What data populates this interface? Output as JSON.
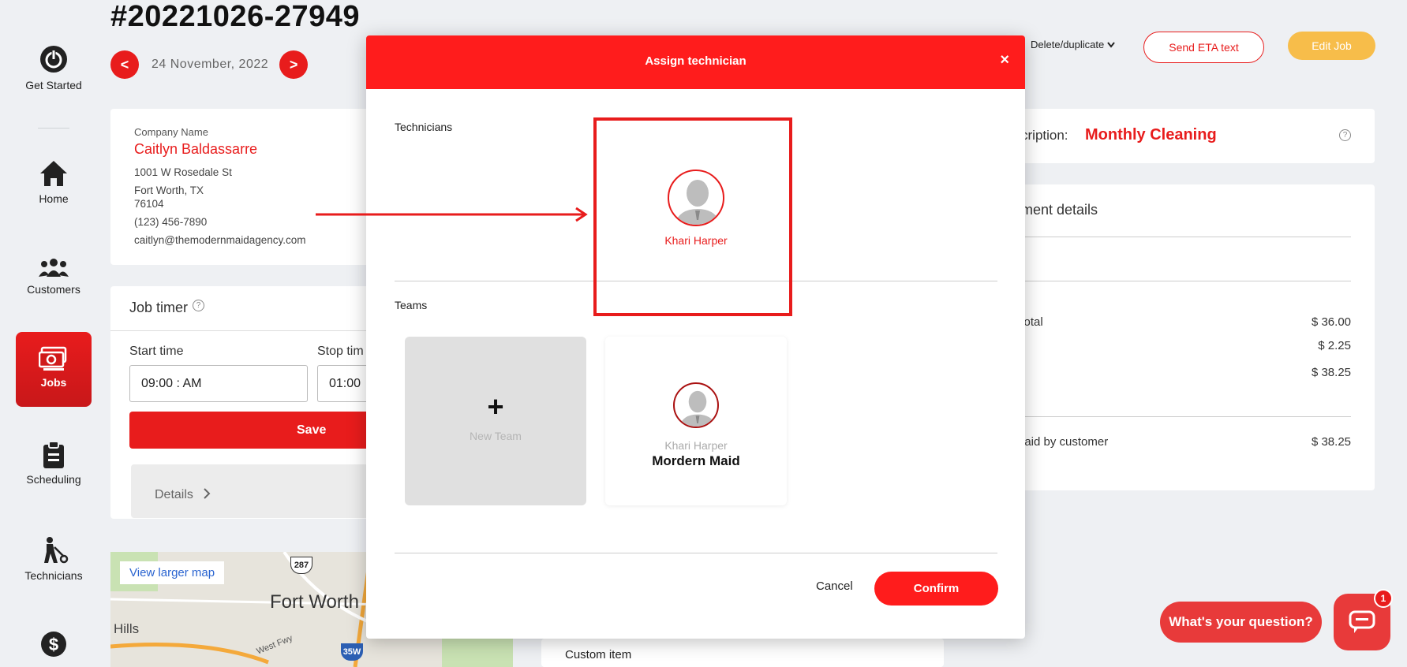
{
  "header": {
    "job_number": "#20221026-27949",
    "date": "24 November, 2022",
    "prev_glyph": "<",
    "next_glyph": ">",
    "delete_duplicate": "Delete/duplicate",
    "send_eta": "Send ETA text",
    "edit_job": "Edit Job"
  },
  "sidebar": {
    "items": [
      {
        "label": "Get Started",
        "icon": "power-icon"
      },
      {
        "label": "Home",
        "icon": "home-icon"
      },
      {
        "label": "Customers",
        "icon": "customers-icon"
      },
      {
        "label": "Jobs",
        "icon": "jobs-icon"
      },
      {
        "label": "Scheduling",
        "icon": "clipboard-icon"
      },
      {
        "label": "Technicians",
        "icon": "technician-icon"
      },
      {
        "label": "",
        "icon": "dollar-icon"
      }
    ]
  },
  "company": {
    "label": "Company Name",
    "name": "Caitlyn Baldassarre",
    "street": "1001 W Rosedale St",
    "city_state": "Fort Worth, TX",
    "zip": "76104",
    "phone": "(123) 456-7890",
    "email": "caitlyn@themodernmaidagency.com"
  },
  "timer": {
    "title": "Job timer",
    "start_label": "Start time",
    "stop_label": "Stop tim",
    "start_value": "09:00 : AM",
    "stop_value": "01:00",
    "save_label": "Save",
    "details_label": "Details"
  },
  "map": {
    "link": "View larger map",
    "city": "Fort Worth",
    "hills": "Hills",
    "freeway": "West Fwy",
    "shield_287": "287",
    "shield_35w": "35W"
  },
  "custom_item": "Custom item",
  "right": {
    "desc_label": "cription:",
    "desc_value": "Monthly Cleaning",
    "payment_title": "ment details",
    "rows": [
      {
        "label": "Total",
        "amount": "$ 36.00"
      },
      {
        "label": "",
        "amount": "$ 2.25"
      },
      {
        "label": "",
        "amount": "$ 38.25"
      },
      {
        "label": "paid by customer",
        "amount": "$ 38.25"
      }
    ]
  },
  "modal": {
    "title": "Assign technician",
    "close": "×",
    "technicians_label": "Technicians",
    "technician_name": "Khari Harper",
    "teams_label": "Teams",
    "new_team_plus": "+",
    "new_team_label": "New Team",
    "team_member": "Khari Harper",
    "team_name": "Mordern Maid",
    "cancel": "Cancel",
    "confirm": "Confirm"
  },
  "chat": {
    "prompt": "What's your question?",
    "badge": "1"
  },
  "colors": {
    "accent": "#e81c1c",
    "edit_button": "#f7bd4a",
    "chat": "#e83a3a"
  }
}
